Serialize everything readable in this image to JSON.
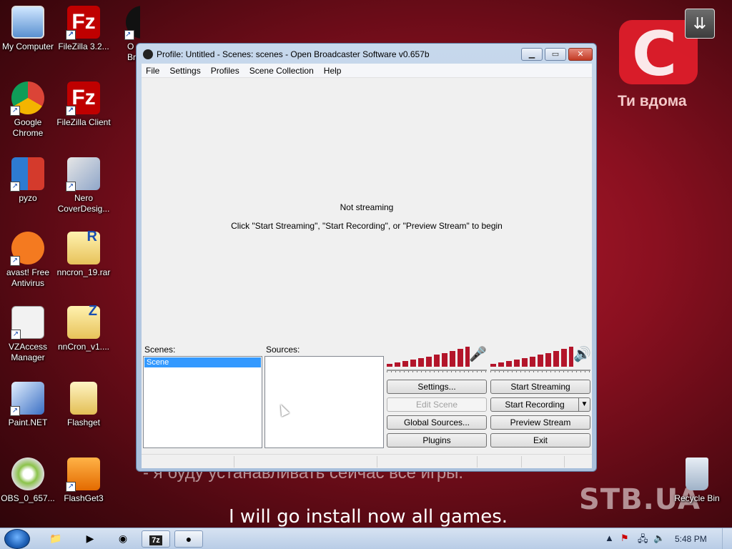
{
  "desktop": {
    "icons": [
      {
        "label": "My Computer"
      },
      {
        "label": "FileZilla 3.2..."
      },
      {
        "label": "O Broa"
      },
      {
        "label": "Google Chrome"
      },
      {
        "label": "FileZilla Client"
      },
      {
        "label": "pyzo"
      },
      {
        "label": "Nero CoverDesig..."
      },
      {
        "label": "avast! Free Antivirus"
      },
      {
        "label": "nncron_19.rar"
      },
      {
        "label": "VZAccess Manager"
      },
      {
        "label": "nnCron_v1...."
      },
      {
        "label": "Paint.NET"
      },
      {
        "label": "Flashget"
      },
      {
        "label": "OBS_0_657..."
      },
      {
        "label": "FlashGet3"
      },
      {
        "label": "Recycle Bin"
      }
    ],
    "background": {
      "channel_text": "Ти вдома",
      "subtitle_ru": "- я буду устанавливать сейчас все игры.",
      "watermark": "STB.UA",
      "subtitle_en": "I will go install now all games."
    }
  },
  "window": {
    "title": "Profile: Untitled - Scenes: scenes - Open Broadcaster Software v0.657b",
    "menu": [
      "File",
      "Settings",
      "Profiles",
      "Scene Collection",
      "Help"
    ],
    "preview": {
      "status": "Not streaming",
      "hint": "Click \"Start Streaming\", \"Start Recording\", or \"Preview Stream\" to begin"
    },
    "scenes_label": "Scenes:",
    "scenes": [
      "Scene"
    ],
    "sources_label": "Sources:",
    "buttons": {
      "settings": "Settings...",
      "edit_scene": "Edit Scene",
      "global_sources": "Global Sources...",
      "plugins": "Plugins",
      "start_streaming": "Start Streaming",
      "start_recording": "Start Recording",
      "preview_stream": "Preview Stream",
      "exit": "Exit"
    }
  },
  "taskbar": {
    "clock": "5:48 PM"
  },
  "colors": {
    "accent_red": "#b3152a",
    "selection_blue": "#3399ff"
  }
}
